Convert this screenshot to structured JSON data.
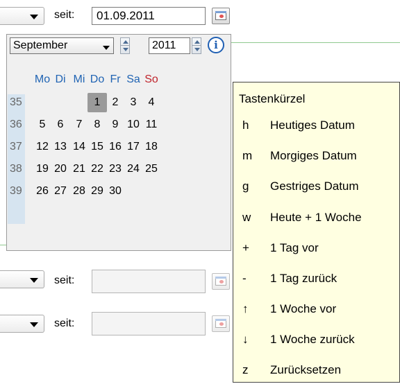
{
  "row1": {
    "seit_label": "seit:",
    "date_value": "01.09.2011"
  },
  "row2": {
    "seit_label": "seit:",
    "date_value": ""
  },
  "row3": {
    "seit_label": "seit:",
    "date_value": ""
  },
  "calendar": {
    "month": "September",
    "year": "2011",
    "info_label": "i",
    "weekday_headers": [
      "Mo",
      "Di",
      "Mi",
      "Do",
      "Fr",
      "Sa",
      "So"
    ],
    "weeks": [
      {
        "number": "35",
        "days": [
          "",
          "",
          "",
          "1",
          "2",
          "3",
          "4"
        ]
      },
      {
        "number": "36",
        "days": [
          "5",
          "6",
          "7",
          "8",
          "9",
          "10",
          "11"
        ]
      },
      {
        "number": "37",
        "days": [
          "12",
          "13",
          "14",
          "15",
          "16",
          "17",
          "18"
        ]
      },
      {
        "number": "38",
        "days": [
          "19",
          "20",
          "21",
          "22",
          "23",
          "24",
          "25"
        ]
      },
      {
        "number": "39",
        "days": [
          "26",
          "27",
          "28",
          "29",
          "30",
          "",
          ""
        ]
      }
    ],
    "selected_day": "1"
  },
  "shortcuts": {
    "title": "Tastenkürzel",
    "items": [
      {
        "key": "h",
        "desc": "Heutiges Datum"
      },
      {
        "key": "m",
        "desc": "Morgiges Datum"
      },
      {
        "key": "g",
        "desc": "Gestriges Datum"
      },
      {
        "key": "w",
        "desc": "Heute + 1 Woche"
      },
      {
        "key": "+",
        "desc": "1 Tag vor"
      },
      {
        "key": "-",
        "desc": "1 Tag zurück"
      },
      {
        "key": "↑",
        "desc": "1 Woche vor"
      },
      {
        "key": "↓",
        "desc": "1 Woche zurück"
      },
      {
        "key": "z",
        "desc": "Zurücksetzen"
      }
    ]
  },
  "colors": {
    "weekday_header": "#1f63b3",
    "sunday_header": "#c0242c",
    "selected_day_bg": "#9a9a9a",
    "tooltip_bg": "#ffffe1",
    "week_column_bg": "#d6e4f0"
  }
}
